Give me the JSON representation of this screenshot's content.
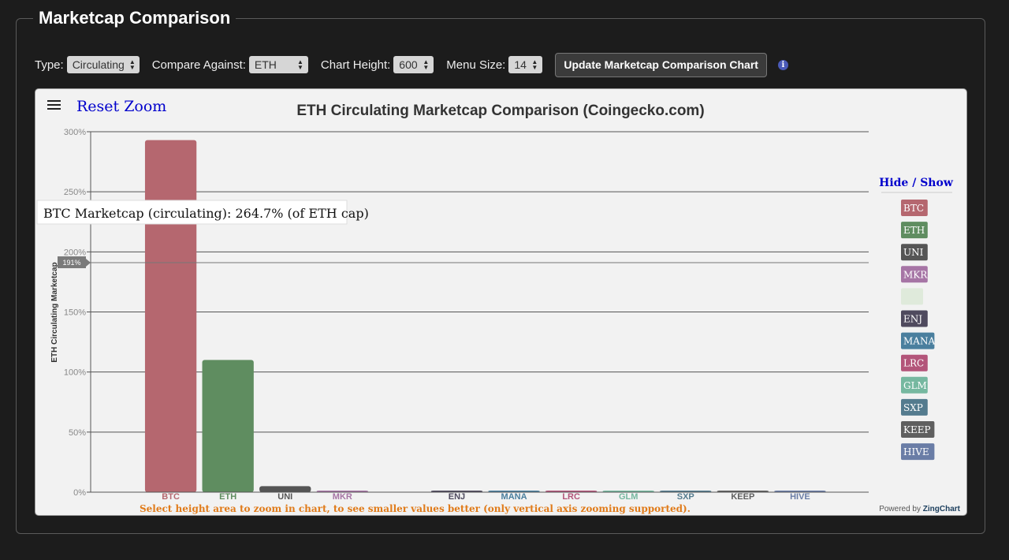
{
  "panel": {
    "title": "Marketcap Comparison"
  },
  "controls": {
    "type_label": "Type:",
    "type_value": "Circulating",
    "compare_label": "Compare Against:",
    "compare_value": "ETH",
    "height_label": "Chart Height:",
    "height_value": "600",
    "menu_label": "Menu Size:",
    "menu_value": "14",
    "update_button": "Update Marketcap Comparison Chart",
    "info_icon": "i"
  },
  "chart_ui": {
    "reset_zoom": "Reset Zoom",
    "hide_show": "Hide / Show",
    "hint": "Select height area to zoom in chart, to see smaller values better (only vertical axis zooming supported).",
    "powered_by": "Powered by",
    "brand": "ZingChart",
    "tooltip": "BTC Marketcap (circulating): 264.7% (of ETH cap)",
    "crosshair_label": "191%",
    "crosshair_value": 191
  },
  "colors": {
    "accent": "#0000cc",
    "hint": "#e07b1a"
  },
  "chart_data": {
    "type": "bar",
    "title": "ETH Circulating Marketcap Comparison (Coingecko.com)",
    "ylabel": "ETH Circulating Marketcap",
    "ylim": [
      0,
      300
    ],
    "yticks": [
      "0%",
      "50%",
      "100%",
      "150%",
      "200%",
      "250%",
      "300%"
    ],
    "yticks_values": [
      0,
      50,
      100,
      150,
      200,
      250,
      300
    ],
    "categories": [
      "BTC",
      "ETH",
      "UNI",
      "MKR",
      "",
      "ENJ",
      "MANA",
      "LRC",
      "GLM",
      "SXP",
      "KEEP",
      "HIVE"
    ],
    "values": [
      293,
      110,
      5,
      1,
      0,
      1,
      1,
      1,
      1,
      1,
      1,
      1
    ],
    "colors": [
      "#b5676f",
      "#5f8d60",
      "#555555",
      "#a675a5",
      "#c9dcc3",
      "#4f4a5e",
      "#4a7f9e",
      "#b3557a",
      "#76b8a0",
      "#547b8e",
      "#5f5f5f",
      "#6a7da6"
    ],
    "legend": [
      {
        "label": "BTC",
        "color": "#b5676f"
      },
      {
        "label": "ETH",
        "color": "#5f8d60"
      },
      {
        "label": "UNI",
        "color": "#555555"
      },
      {
        "label": "MKR",
        "color": "#a675a5"
      },
      {
        "label": "",
        "color": "#dfeadb"
      },
      {
        "label": "ENJ",
        "color": "#4f4a5e"
      },
      {
        "label": "MANA",
        "color": "#4a7f9e"
      },
      {
        "label": "LRC",
        "color": "#b3557a"
      },
      {
        "label": "GLM",
        "color": "#76b8a0"
      },
      {
        "label": "SXP",
        "color": "#547b8e"
      },
      {
        "label": "KEEP",
        "color": "#5f5f5f"
      },
      {
        "label": "HIVE",
        "color": "#6a7da6"
      }
    ]
  }
}
